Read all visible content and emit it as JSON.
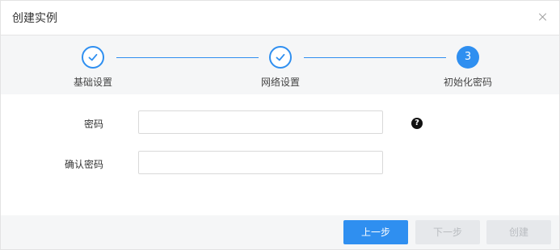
{
  "dialog": {
    "title": "创建实例"
  },
  "steps": [
    {
      "label": "基础设置",
      "status": "done"
    },
    {
      "label": "网络设置",
      "status": "done"
    },
    {
      "label": "初始化密码",
      "status": "active",
      "number": "3"
    }
  ],
  "form": {
    "password_label": "密码",
    "confirm_label": "确认密码",
    "password_value": "",
    "confirm_value": ""
  },
  "footer": {
    "prev_label": "上一步",
    "next_label": "下一步",
    "create_label": "创建"
  },
  "colors": {
    "accent": "#2f8ff0",
    "disabled_bg": "#e6e8eb",
    "step_bg": "#f5f6f7"
  },
  "icons": {
    "close": "close-icon",
    "help": "question-circle-icon",
    "done": "check-icon"
  }
}
